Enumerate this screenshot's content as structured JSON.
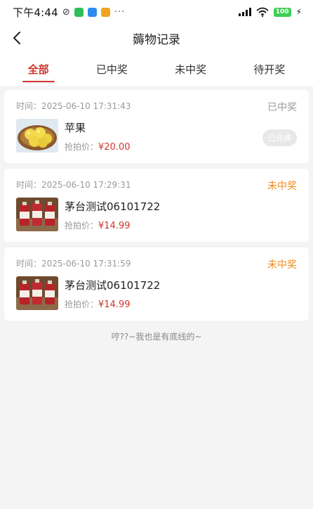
{
  "status_bar": {
    "time": "下午4:44",
    "dots": "···",
    "battery": "100",
    "colors": {
      "app1": "#2fbf5a",
      "app2": "#2b8cf0",
      "app3": "#f0a422",
      "battery": "#3ecf56"
    }
  },
  "header": {
    "back_icon": "chevron-left-icon",
    "title": "薅物记录"
  },
  "tabs": [
    {
      "label": "全部",
      "active": true
    },
    {
      "label": "已中奖",
      "active": false
    },
    {
      "label": "未中奖",
      "active": false
    },
    {
      "label": "待开奖",
      "active": false
    }
  ],
  "records": [
    {
      "time_label": "时间：2025-06-10 17:31:43",
      "status": "已中奖",
      "status_color": "#999999",
      "name": "苹果",
      "price_label": "抢拍价：",
      "price": "¥20.00",
      "action": "已兑换",
      "image": "apples"
    },
    {
      "time_label": "时间：2025-06-10 17:29:31",
      "status": "未中奖",
      "status_color": "#f08a1c",
      "name": "茅台测试06101722",
      "price_label": "抢拍价：",
      "price": "¥14.99",
      "image": "maotai"
    },
    {
      "time_label": "时间：2025-06-10 17:31:59",
      "status": "未中奖",
      "status_color": "#f08a1c",
      "name": "茅台测试06101722",
      "price_label": "抢拍价：",
      "price": "¥14.99",
      "image": "maotai"
    }
  ],
  "footer_note": "哼??~我也是有底线的~",
  "accent_color": "#d0342c"
}
